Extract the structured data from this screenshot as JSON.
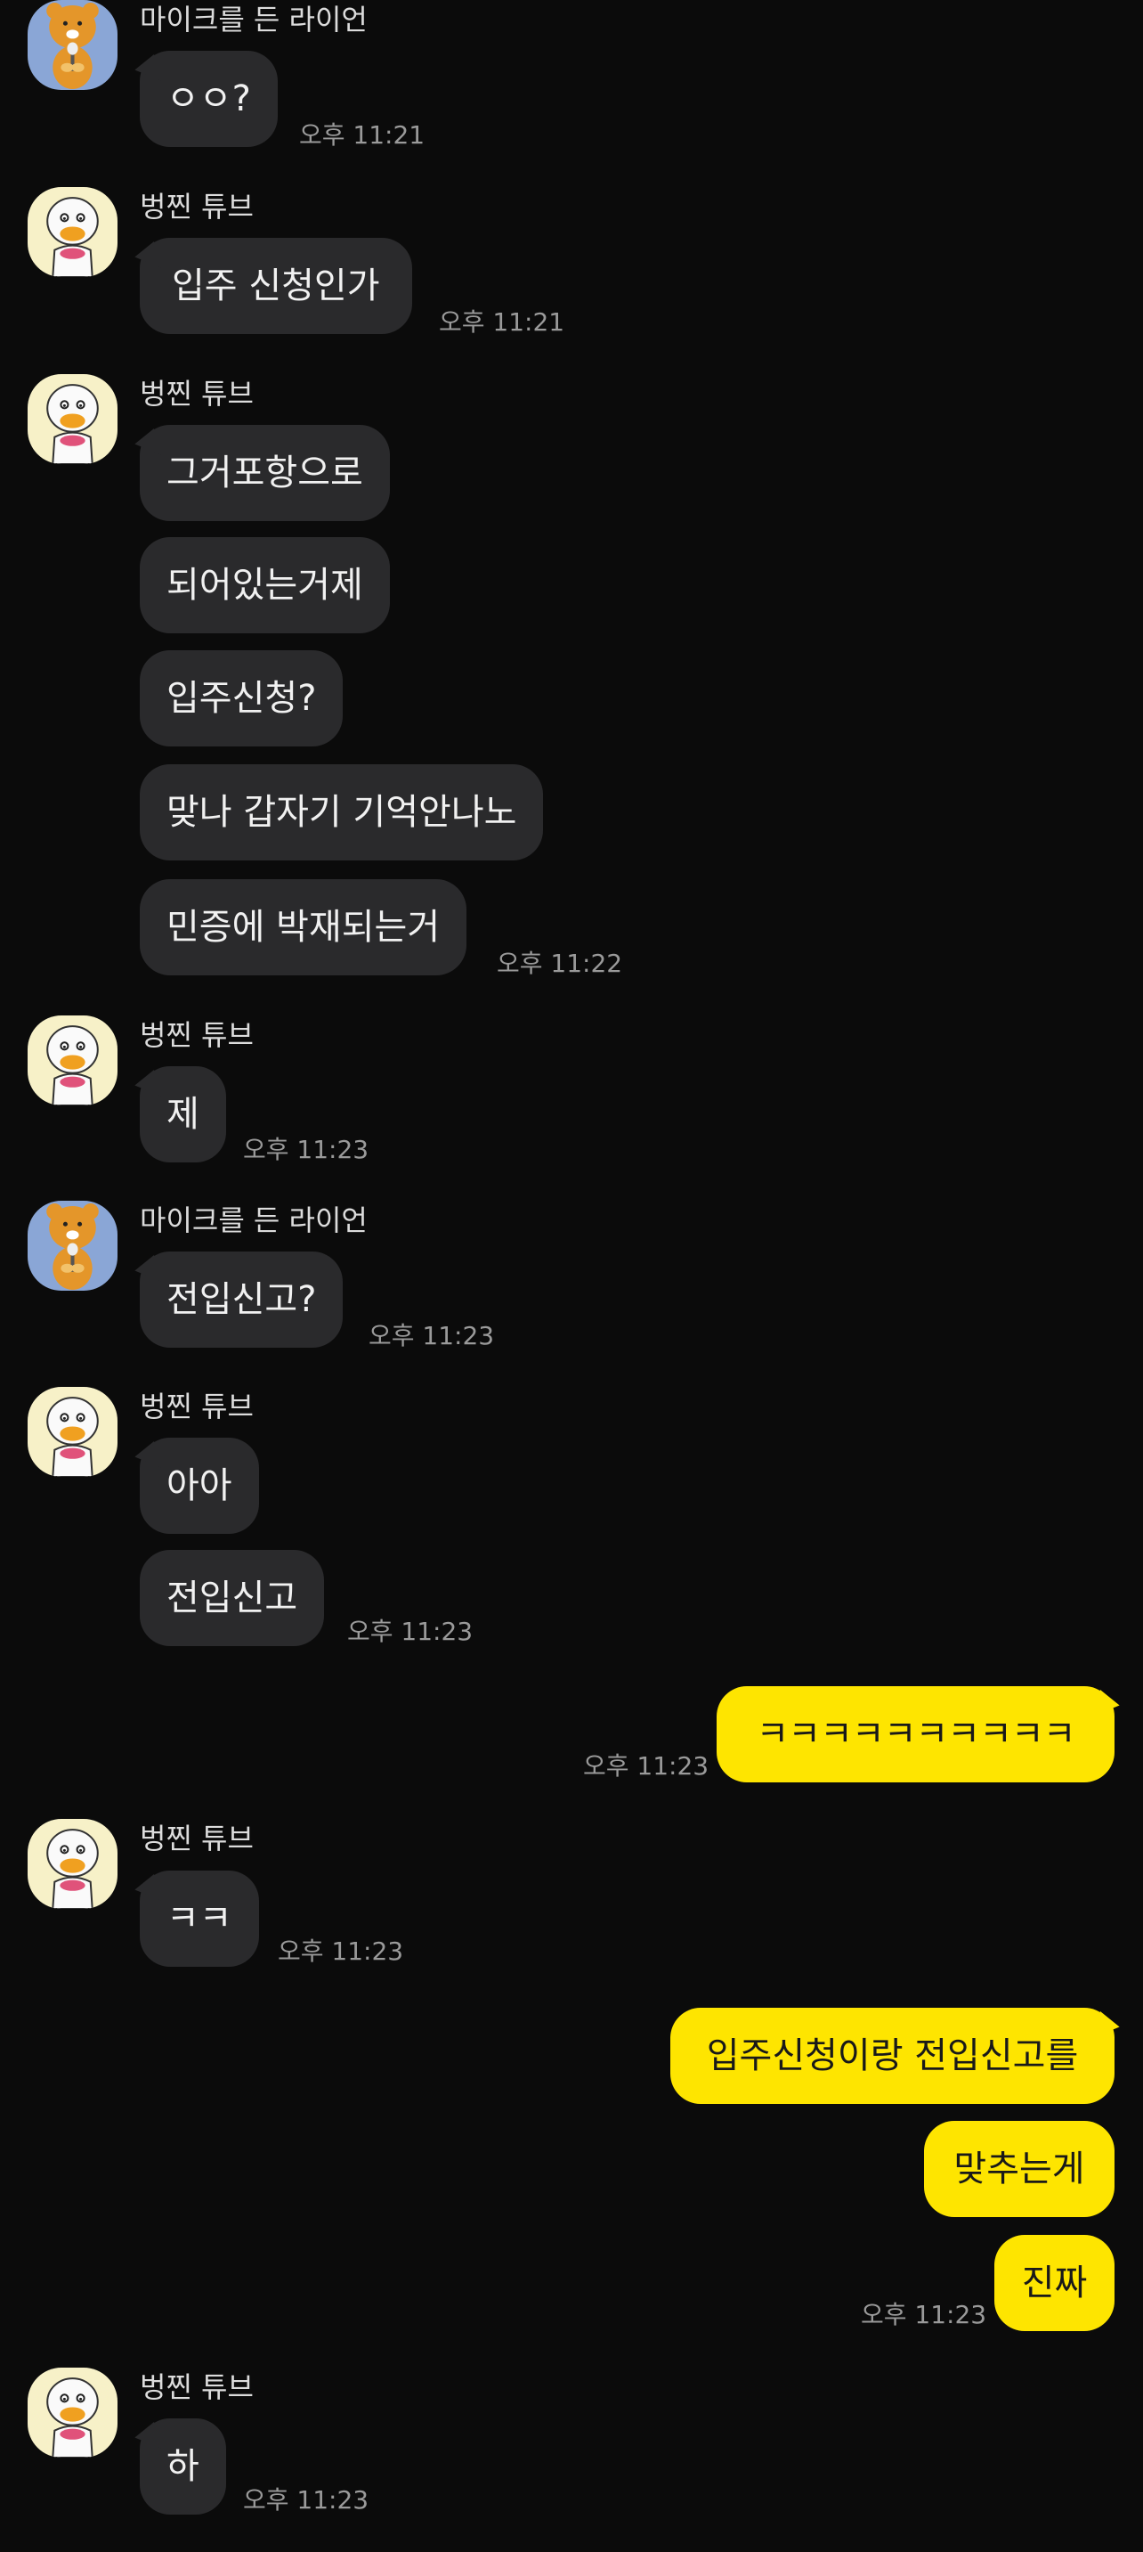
{
  "colors": {
    "background": "#0b0b0b",
    "incoming_bubble": "#2a2a2c",
    "outgoing_bubble": "#fee500",
    "timestamp": "#9a9a9a"
  },
  "senders": {
    "ryan": "마이크를 든 라이언",
    "tube": "벙찐 튜브"
  },
  "messages": [
    {
      "sender": "마이크를 든 라이언",
      "avatar": "ryan-avatar",
      "text": "ㅇㅇ?",
      "time": "오후 11:21"
    },
    {
      "sender": "벙찐 튜브",
      "avatar": "tube-avatar",
      "text": "입주 신청인가",
      "time": "오후 11:21"
    },
    {
      "sender": "벙찐 튜브",
      "avatar": "tube-avatar",
      "text": "그거포항으로"
    },
    {
      "text": "되어있는거제"
    },
    {
      "text": "입주신청?"
    },
    {
      "text": "맞나 갑자기 기억안나노"
    },
    {
      "text": "민증에 박재되는거",
      "time": "오후 11:22"
    },
    {
      "sender": "벙찐 튜브",
      "avatar": "tube-avatar",
      "text": "제",
      "time": "오후 11:23"
    },
    {
      "sender": "마이크를 든 라이언",
      "avatar": "ryan-avatar",
      "text": "전입신고?",
      "time": "오후 11:23"
    },
    {
      "sender": "벙찐 튜브",
      "avatar": "tube-avatar",
      "text": "아아"
    },
    {
      "text": "전입신고",
      "time": "오후 11:23"
    },
    {
      "mine": true,
      "text": "ㅋㅋㅋㅋㅋㅋㅋㅋㅋㅋ",
      "time": "오후 11:23"
    },
    {
      "sender": "벙찐 튜브",
      "avatar": "tube-avatar",
      "text": "ㅋㅋ",
      "time": "오후 11:23"
    },
    {
      "mine": true,
      "text": "입주신청이랑 전입신고를"
    },
    {
      "mine": true,
      "text": "맞추는게"
    },
    {
      "mine": true,
      "text": "진짜",
      "time": "오후 11:23"
    },
    {
      "sender": "벙찐 튜브",
      "avatar": "tube-avatar",
      "text": "하",
      "time": "오후 11:23"
    }
  ]
}
